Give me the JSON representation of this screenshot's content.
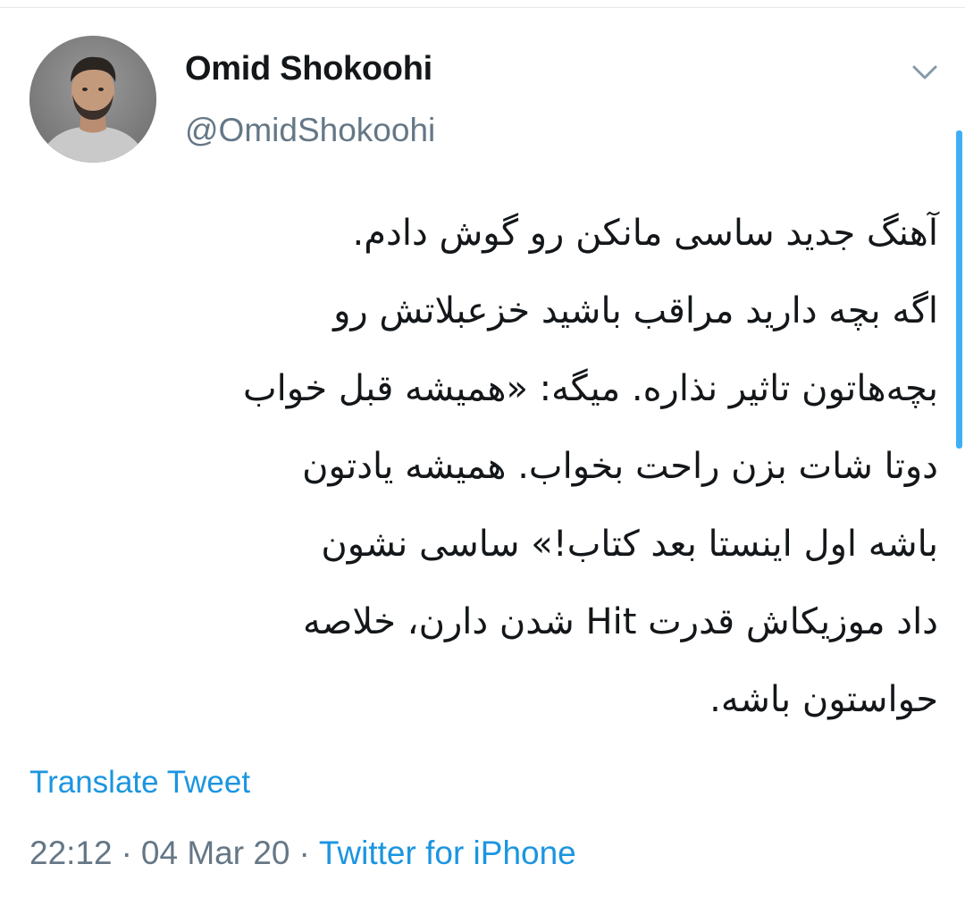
{
  "author": {
    "display_name": "Omid Shokoohi",
    "handle": "@OmidShokoohi",
    "avatar_icon": "profile-photo"
  },
  "header": {
    "menu_icon": "chevron-down-icon"
  },
  "tweet": {
    "lines": [
      "آهنگ جدید ساسی مانکن رو گوش دادم.",
      "اگه بچه دارید مراقب باشید خزعبلاتش رو",
      "بچه‌هاتون تاثیر نذاره. میگه: «همیشه قبل خواب",
      "دوتا شات بزن راحت بخواب. همیشه یادتون",
      "باشه اول اینستا بعد کتاب!» ساسی نشون",
      "داد موزیکاش قدرت Hit شدن دارن، خلاصه",
      "حواستون باشه."
    ]
  },
  "actions": {
    "translate_label": "Translate Tweet"
  },
  "meta": {
    "time": "22:12",
    "separator": "·",
    "date": "04 Mar 20",
    "source": "Twitter for iPhone"
  },
  "colors": {
    "link": "#1b95e0",
    "secondary_text": "#657786",
    "primary_text": "#14171a"
  }
}
